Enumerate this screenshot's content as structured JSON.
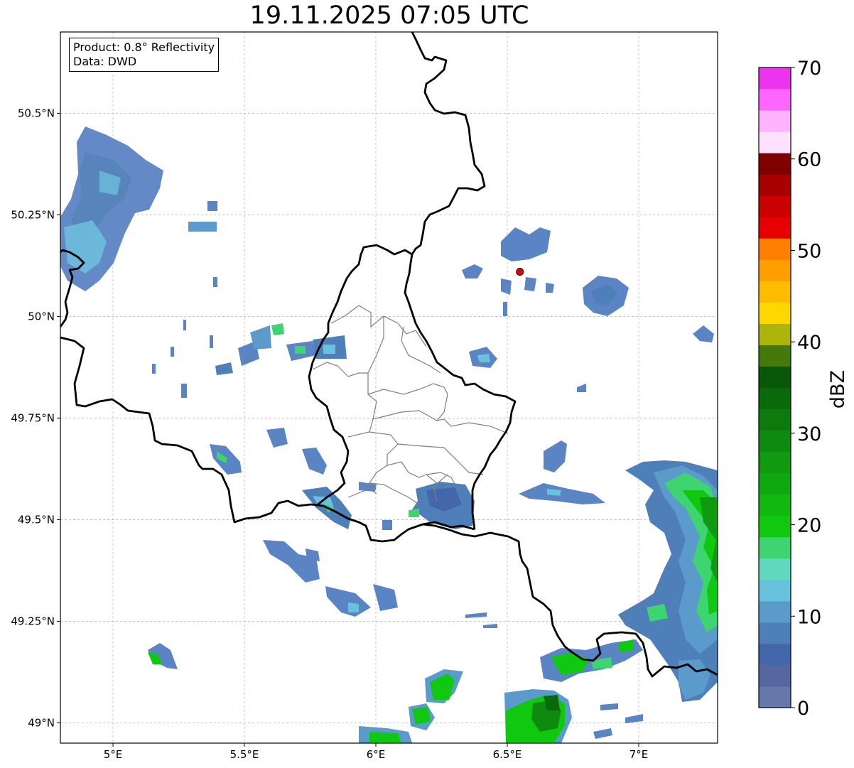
{
  "title": "19.11.2025 07:05 UTC",
  "info": {
    "product": "Product: 0.8° Reflectivity",
    "data": "Data: DWD"
  },
  "axes": {
    "lon_range": [
      4.8,
      7.3
    ],
    "lat_range": [
      48.95,
      50.7
    ],
    "x_ticks": [
      {
        "value": 5.0,
        "label": "5°E"
      },
      {
        "value": 5.5,
        "label": "5.5°E"
      },
      {
        "value": 6.0,
        "label": "6°E"
      },
      {
        "value": 6.5,
        "label": "6.5°E"
      },
      {
        "value": 7.0,
        "label": "7°E"
      }
    ],
    "y_ticks": [
      {
        "value": 50.5,
        "label": "50.5°N"
      },
      {
        "value": 50.25,
        "label": "50.25°N"
      },
      {
        "value": 50.0,
        "label": "50°N"
      },
      {
        "value": 49.75,
        "label": "49.75°N"
      },
      {
        "value": 49.5,
        "label": "49.5°N"
      },
      {
        "value": 49.25,
        "label": "49.25°N"
      },
      {
        "value": 49.0,
        "label": "49°N"
      }
    ],
    "grid": true
  },
  "radar_site": {
    "lon": 6.548,
    "lat": 50.11,
    "color": "#e80000"
  },
  "colorbar": {
    "label": "dBZ",
    "min": 0,
    "max": 70,
    "ticks": [
      "0",
      "10",
      "20",
      "30",
      "40",
      "50",
      "60",
      "70"
    ],
    "colors": [
      "#6677aa",
      "#5566a0",
      "#4466aa",
      "#4f7fb8",
      "#5b9bcc",
      "#68c2de",
      "#60d8c0",
      "#3ed470",
      "#11c811",
      "#10b810",
      "#10a810",
      "#0f9a0f",
      "#0e8a0e",
      "#0c7a0c",
      "#0a6a0a",
      "#085808",
      "#457a0a",
      "#adb50a",
      "#ffd700",
      "#ffbb00",
      "#ff9e00",
      "#ff7f00",
      "#e60000",
      "#cc0000",
      "#a80000",
      "#800000",
      "#ffe1ff",
      "#ffb3ff",
      "#ff66ff",
      "#ee33ee"
    ]
  }
}
